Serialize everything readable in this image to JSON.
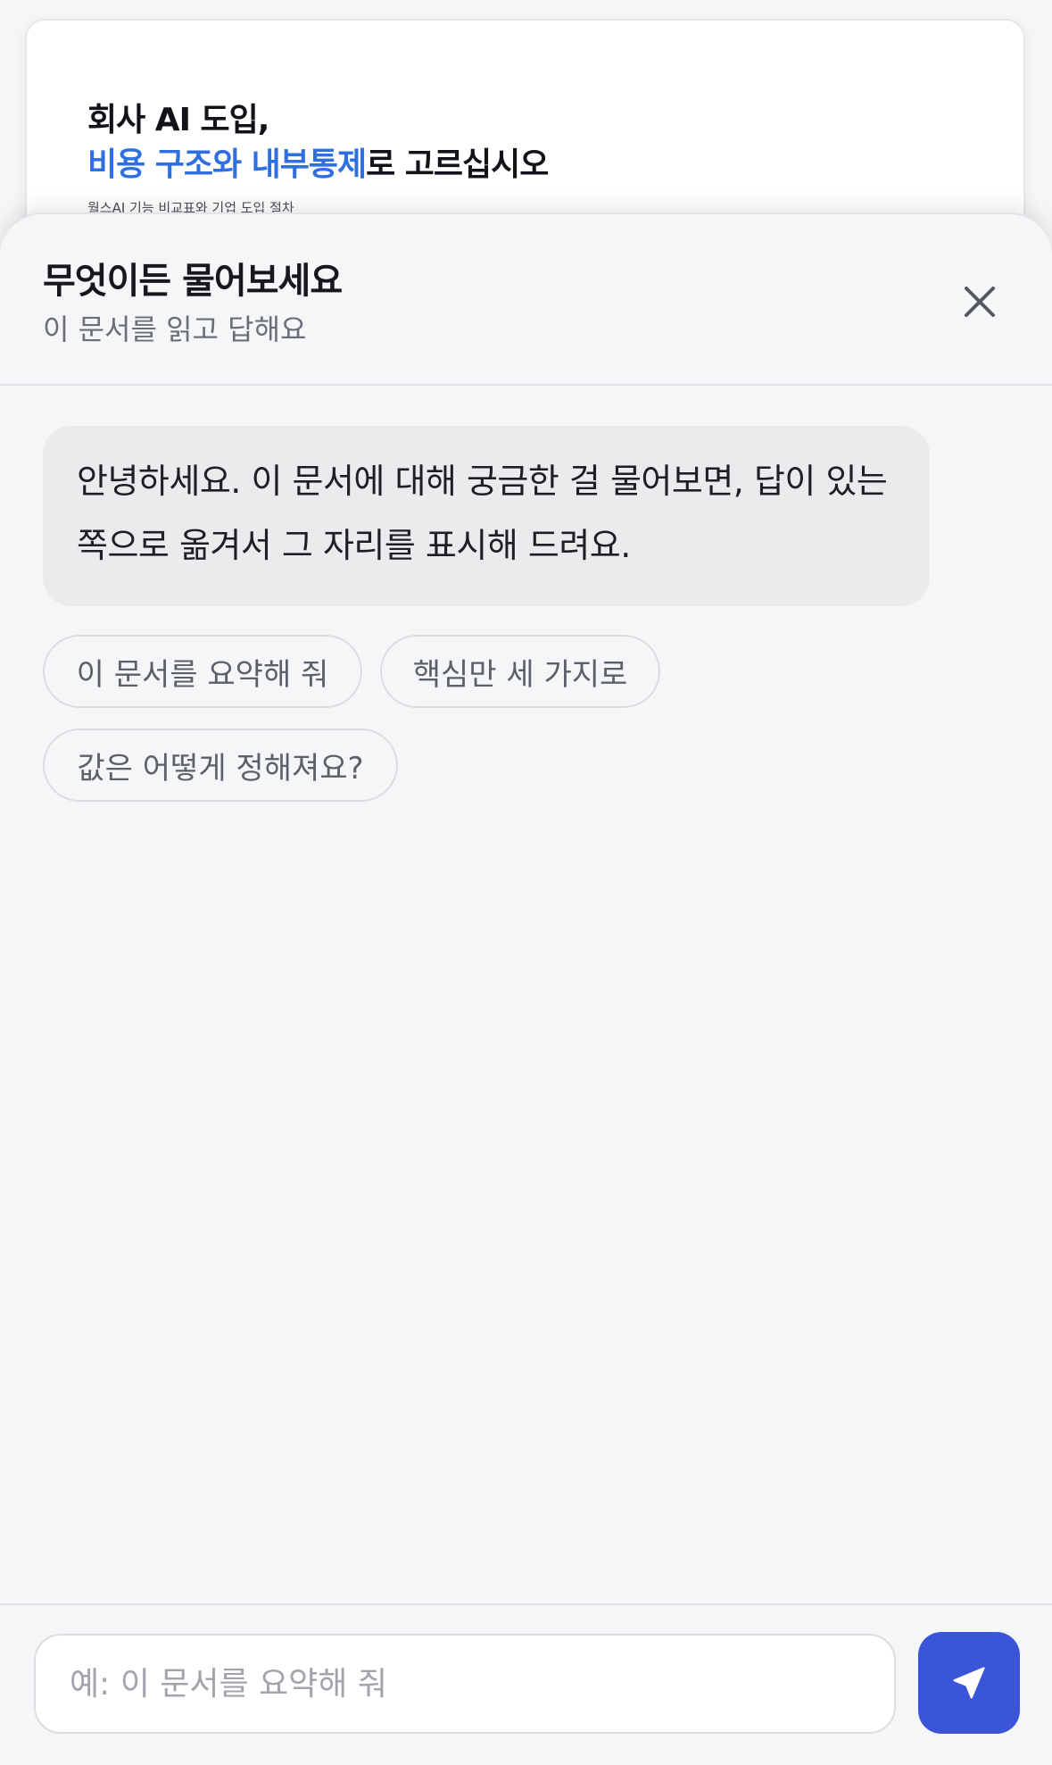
{
  "document": {
    "title_line1": "회사 AI 도입,",
    "title_line2_accent": "비용 구조와 내부통제",
    "title_line2_rest": "로 고르십시오",
    "subtitle": "월스AI 기능 비교표와 기업 도입 절차"
  },
  "sheet": {
    "title": "무엇이든 물어보세요",
    "subtitle": "이 문서를 읽고 답해요",
    "close_icon": "close-icon"
  },
  "conversation": {
    "assistant_message": "안녕하세요. 이 문서에 대해 궁금한 걸 물어보면, 답이 있는 쪽으로 옮겨서 그 자리를 표시해 드려요.",
    "suggestions": [
      {
        "label": "이 문서를 요약해 줘"
      },
      {
        "label": "핵심만 세 가지로"
      },
      {
        "label": "값은 어떻게 정해져요?"
      }
    ]
  },
  "composer": {
    "placeholder": "예: 이 문서를 요약해 줘",
    "value": "",
    "send_icon": "send-icon"
  },
  "colors": {
    "accent": "#2f6fe0",
    "send_button": "#3a55d8",
    "bubble": "#ebebed",
    "background": "#f5f6f8"
  }
}
